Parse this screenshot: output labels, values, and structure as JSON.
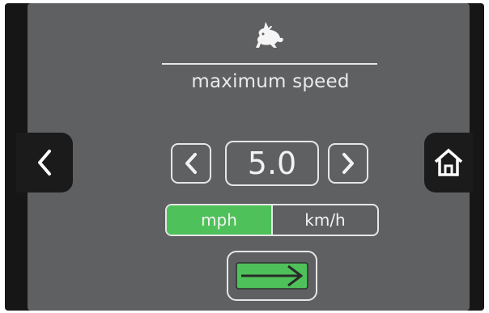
{
  "screen": {
    "title": "maximum speed",
    "speed_value": "5.0",
    "units": [
      {
        "label": "mph",
        "selected": true
      },
      {
        "label": "km/h",
        "selected": false
      }
    ]
  },
  "icons": {
    "header": "rabbit-icon",
    "back": "chevron-left-icon",
    "home": "home-icon",
    "decrease": "chevron-left-icon",
    "increase": "chevron-right-icon",
    "next": "arrow-right-icon"
  },
  "colors": {
    "accent": "#4fc15a",
    "panel": "#5f6062",
    "frame": "#161616"
  }
}
